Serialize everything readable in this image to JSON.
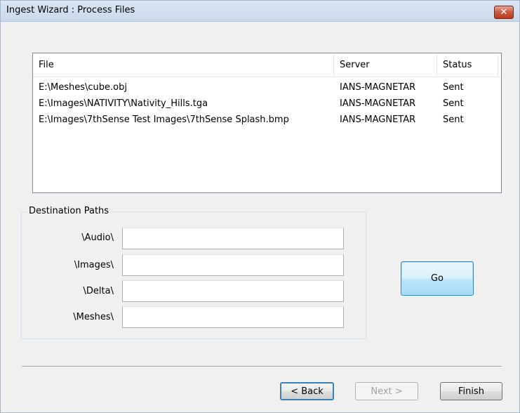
{
  "window": {
    "title": "Ingest Wizard : Process Files",
    "close_glyph": "✕"
  },
  "file_list": {
    "columns": [
      "File",
      "Server",
      "Status"
    ],
    "rows": [
      {
        "file": "E:\\Meshes\\cube.obj",
        "server": "IANS-MAGNETAR",
        "status": "Sent"
      },
      {
        "file": "E:\\Images\\NATIVITY\\Nativity_Hills.tga",
        "server": "IANS-MAGNETAR",
        "status": "Sent"
      },
      {
        "file": "E:\\Images\\7thSense Test Images\\7thSense Splash.bmp",
        "server": "IANS-MAGNETAR",
        "status": "Sent"
      }
    ]
  },
  "destination_paths": {
    "legend": "Destination Paths",
    "fields": [
      {
        "label": "\\Audio\\",
        "value": ""
      },
      {
        "label": "\\Images\\",
        "value": ""
      },
      {
        "label": "\\Delta\\",
        "value": ""
      },
      {
        "label": "\\Meshes\\",
        "value": ""
      }
    ]
  },
  "buttons": {
    "go": "Go",
    "back": "< Back",
    "next": "Next >",
    "finish": "Finish"
  },
  "colors": {
    "accent": "#3c7fb1",
    "close_red": "#c85a42"
  }
}
